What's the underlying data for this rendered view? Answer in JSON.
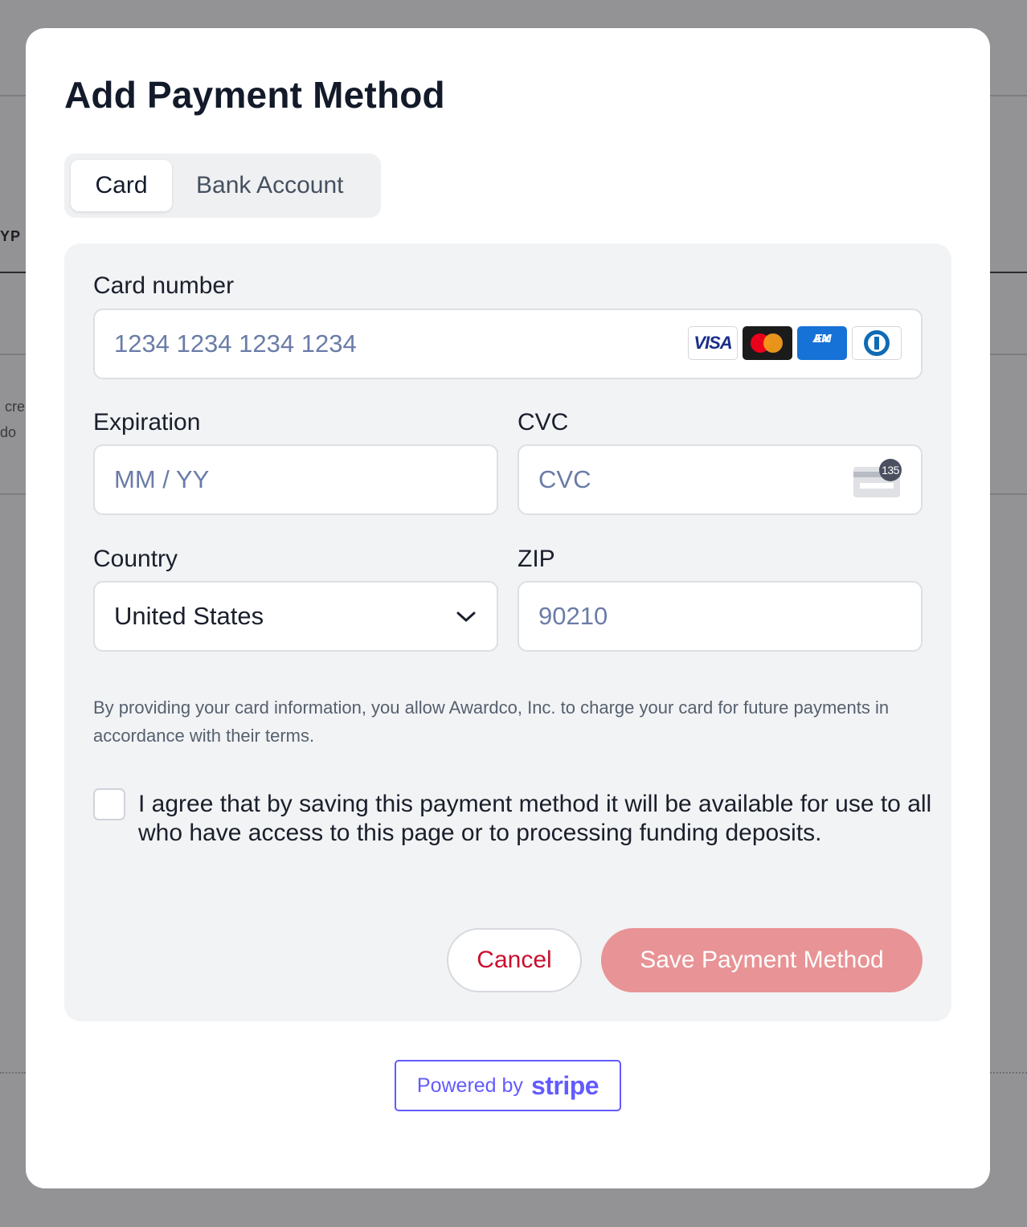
{
  "background": {
    "fragment_type": "YP",
    "fragment_line1": "cre",
    "fragment_line2": "do"
  },
  "modal": {
    "title": "Add Payment Method",
    "tabs": [
      {
        "label": "Card",
        "active": true
      },
      {
        "label": "Bank Account",
        "active": false
      }
    ],
    "form": {
      "card_number_label": "Card number",
      "card_number_placeholder": "1234 1234 1234 1234",
      "card_brands": [
        "visa-icon",
        "mastercard-icon",
        "amex-icon",
        "diners-icon"
      ],
      "visa_text": "VISA",
      "amex_text_1": "AM",
      "amex_text_2": "EX",
      "expiration_label": "Expiration",
      "expiration_placeholder": "MM / YY",
      "cvc_label": "CVC",
      "cvc_placeholder": "CVC",
      "cvc_badge": "135",
      "country_label": "Country",
      "country_value": "United States",
      "zip_label": "ZIP",
      "zip_placeholder": "90210"
    },
    "disclaimer": "By providing your card information, you allow Awardco, Inc. to charge your card for future payments in accordance with their terms.",
    "agree_checkbox_checked": false,
    "agree_text": "I agree that by saving this payment method it will be available for use to all who have access to this page or to processing funding deposits.",
    "buttons": {
      "cancel": "Cancel",
      "save": "Save Payment Method"
    },
    "powered_by": {
      "prefix": "Powered by",
      "brand": "stripe"
    }
  },
  "colors": {
    "accent": "#c8102e",
    "save_button_disabled": "#e89395",
    "stripe": "#635bff"
  }
}
